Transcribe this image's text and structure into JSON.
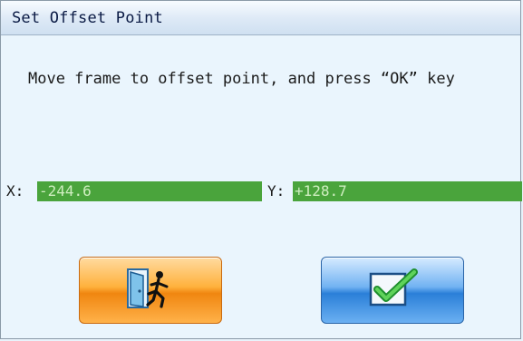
{
  "window": {
    "title": "Set Offset Point"
  },
  "message": "Move frame to offset point, and press “OK” key",
  "coordinates": {
    "x_label": "X:",
    "x_value": "-244.6",
    "y_label": "Y:",
    "y_value": "+128.7"
  },
  "buttons": {
    "exit_icon": "exit-door-icon",
    "ok_icon": "checkmark-icon"
  },
  "colors": {
    "value_background": "#4aa43c",
    "exit_button": "#f08610",
    "ok_button": "#2a7fd8"
  }
}
